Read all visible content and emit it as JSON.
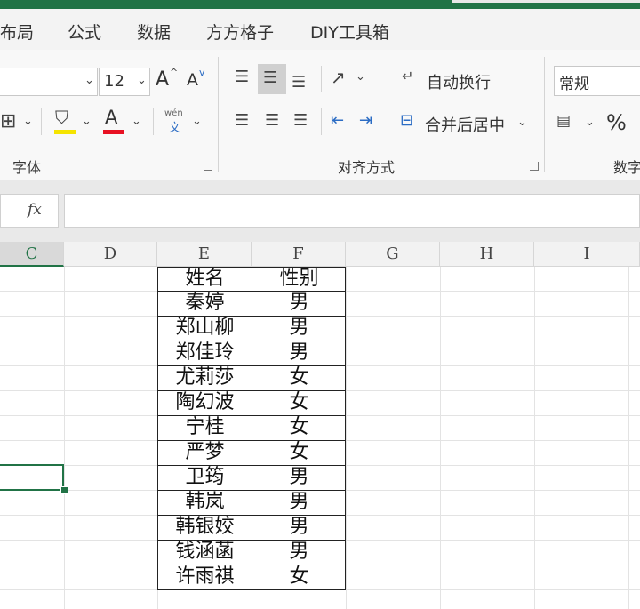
{
  "tabs": [
    "布局",
    "公式",
    "数据",
    "方方格子",
    "DIY工具箱"
  ],
  "ribbon": {
    "font_size": "12",
    "grow_font": "A",
    "shrink_font": "A",
    "font_color_letter": "A",
    "phonetic_top": "wén",
    "phonetic_bottom": "文",
    "wrap_text_label": "自动换行",
    "merge_center_label": "合并后居中",
    "number_format": "常规",
    "percent_symbol": "%",
    "group_font": "字体",
    "group_alignment": "对齐方式",
    "group_number": "数字",
    "accent_fill": "#f5e400",
    "accent_font": "#e81123"
  },
  "formula_bar": {
    "fx_label": "fx",
    "value": ""
  },
  "grid": {
    "columns": [
      "C",
      "D",
      "E",
      "F",
      "G",
      "H",
      "I"
    ],
    "selected_column": "C",
    "table": {
      "headers": [
        "姓名",
        "性别"
      ],
      "rows": [
        [
          "秦婷",
          "男"
        ],
        [
          "郑山柳",
          "男"
        ],
        [
          "郑佳玲",
          "男"
        ],
        [
          "尤莉莎",
          "女"
        ],
        [
          "陶幻波",
          "女"
        ],
        [
          "宁桂",
          "女"
        ],
        [
          "严梦",
          "女"
        ],
        [
          "卫筠",
          "男"
        ],
        [
          "韩岚",
          "男"
        ],
        [
          "韩银姣",
          "男"
        ],
        [
          "钱涵菡",
          "男"
        ],
        [
          "许雨祺",
          "女"
        ]
      ]
    }
  }
}
